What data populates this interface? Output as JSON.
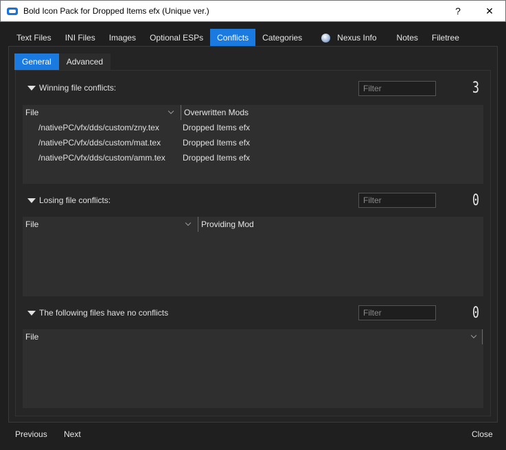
{
  "window": {
    "title": "Bold Icon Pack for Dropped Items efx (Unique ver.)",
    "help_label": "?",
    "close_label": "✕"
  },
  "tabs": [
    {
      "label": "Text Files"
    },
    {
      "label": "INI Files"
    },
    {
      "label": "Images"
    },
    {
      "label": "Optional ESPs"
    },
    {
      "label": "Conflicts"
    },
    {
      "label": "Categories"
    },
    {
      "label": "Nexus Info"
    },
    {
      "label": "Notes"
    },
    {
      "label": "Filetree"
    }
  ],
  "subtabs": [
    {
      "label": "General"
    },
    {
      "label": "Advanced"
    }
  ],
  "winning": {
    "title": "Winning file conflicts:",
    "filter_placeholder": "Filter",
    "count": "3",
    "columns": [
      "File",
      "Overwritten Mods"
    ],
    "rows": [
      {
        "file": "/nativePC/vfx/dds/custom/zny.tex",
        "mod": "Dropped Items efx"
      },
      {
        "file": "/nativePC/vfx/dds/custom/mat.tex",
        "mod": "Dropped Items efx"
      },
      {
        "file": "/nativePC/vfx/dds/custom/amm.tex",
        "mod": "Dropped Items efx"
      }
    ]
  },
  "losing": {
    "title": "Losing file conflicts:",
    "filter_placeholder": "Filter",
    "count": "0",
    "columns": [
      "File",
      "Providing Mod"
    ]
  },
  "noconflict": {
    "title": "The following files have no conflicts",
    "filter_placeholder": "Filter",
    "count": "0",
    "columns": [
      "File"
    ]
  },
  "footer": {
    "previous": "Previous",
    "next": "Next",
    "close": "Close"
  }
}
